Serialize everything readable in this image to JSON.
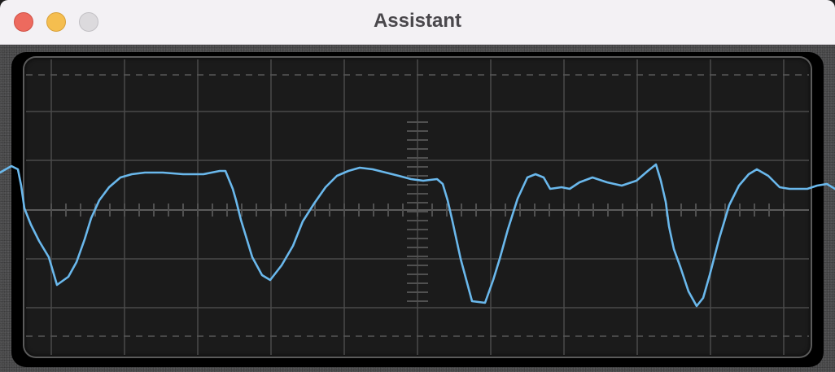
{
  "window": {
    "title": "Assistant"
  },
  "traffic_lights": {
    "close_color": "#ed6a5e",
    "minimize_color": "#f5be4f",
    "zoom_color": "#dcdadd"
  },
  "display": {
    "background_color": "#1b1b1b",
    "grid_color": "#4a4a4a",
    "trace_color": "#6ab8ec"
  },
  "waveform": {
    "x": [
      0,
      14,
      22,
      26,
      30,
      38,
      48,
      60,
      70,
      84,
      94,
      104,
      112,
      122,
      134,
      148,
      162,
      178,
      200,
      225,
      250,
      270,
      277,
      286,
      290,
      296,
      310,
      322,
      332,
      346,
      360,
      372,
      386,
      400,
      414,
      428,
      442,
      458,
      474,
      490,
      505,
      520,
      537,
      544,
      550,
      556,
      566,
      580,
      596,
      606,
      614,
      624,
      636,
      648,
      658,
      668,
      676,
      690,
      700,
      712,
      728,
      746,
      764,
      782,
      796,
      806,
      812,
      818,
      822,
      828,
      836,
      846,
      856,
      864,
      872,
      884,
      896,
      908,
      920,
      930,
      944,
      958,
      970,
      980,
      992,
      1004,
      1016,
      1026
    ],
    "y": [
      2.3,
      2.7,
      2.5,
      1.5,
      0.1,
      -0.9,
      -1.9,
      -2.9,
      -4.6,
      -4.1,
      -3.2,
      -1.8,
      -0.5,
      0.6,
      1.4,
      2.0,
      2.2,
      2.3,
      2.3,
      2.2,
      2.2,
      2.4,
      2.4,
      1.3,
      0.6,
      -0.6,
      -2.9,
      -4.0,
      -4.3,
      -3.4,
      -2.2,
      -0.7,
      0.4,
      1.4,
      2.1,
      2.4,
      2.6,
      2.5,
      2.3,
      2.1,
      1.9,
      1.8,
      1.9,
      1.6,
      0.6,
      -0.7,
      -3.0,
      -5.6,
      -5.7,
      -4.3,
      -3.0,
      -1.2,
      0.7,
      2.0,
      2.2,
      2.0,
      1.3,
      1.4,
      1.3,
      1.7,
      2.0,
      1.7,
      1.5,
      1.8,
      2.4,
      2.8,
      1.8,
      0.5,
      -1.0,
      -2.4,
      -3.5,
      -5.0,
      -5.9,
      -5.4,
      -4.0,
      -1.7,
      0.3,
      1.5,
      2.2,
      2.5,
      2.1,
      1.4,
      1.3,
      1.3,
      1.3,
      1.5,
      1.6,
      1.3
    ],
    "ylim": [
      -6.5,
      6.5
    ]
  }
}
